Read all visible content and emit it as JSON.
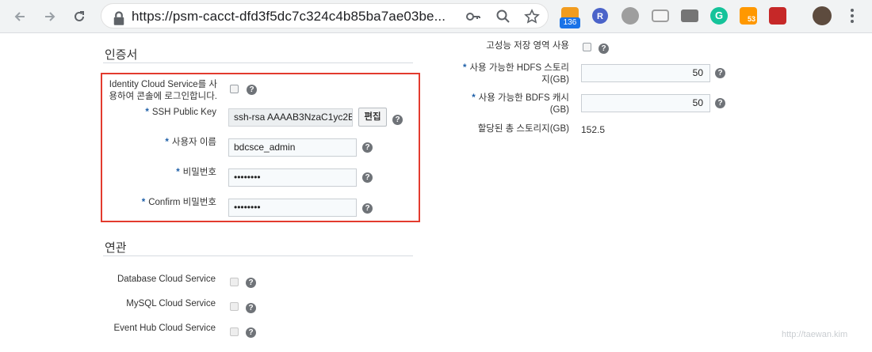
{
  "browser": {
    "url_main": "https://psm-cacct-dfd3f5dc7c324c4b85ba7ae03be...",
    "ext_badge_count": "136",
    "ext_r_label": "R",
    "ext_g_label": "G",
    "ext_53_label": "53"
  },
  "credentials": {
    "title": "인증서",
    "identity_label_line1": "Identity Cloud Service를 사",
    "identity_label_line2": "용하여 콘솔에 로그인합니다.",
    "ssh_label": "SSH Public Key",
    "ssh_value": "ssh-rsa AAAAB3NzaC1yc2E",
    "edit_button": "편집",
    "username_label": "사용자 이름",
    "username_value": "bdcsce_admin",
    "password_label": "비밀번호",
    "password_value": "••••••••",
    "confirm_label": "Confirm 비밀번호",
    "confirm_value": "••••••••"
  },
  "associations": {
    "title": "연관",
    "items": [
      {
        "label": "Database Cloud Service"
      },
      {
        "label": "MySQL Cloud Service"
      },
      {
        "label": "Event Hub Cloud Service"
      }
    ]
  },
  "storage": {
    "high_perf_label": "고성능 저장 영역 사용",
    "hdfs_label_line1": "사용 가능한 HDFS 스토리",
    "hdfs_label_line2": "지(GB)",
    "hdfs_value": "50",
    "bdfs_label_line1": "사용 가능한 BDFS 캐시",
    "bdfs_label_line2": "(GB)",
    "bdfs_value": "50",
    "total_label": "할당된 총 스토리지(GB)",
    "total_value": "152.5"
  },
  "help_glyph": "?",
  "required_mark": "*",
  "watermark": "http://taewan.kim",
  "colors": {
    "highlight_border": "#e33b2e",
    "required_star": "#1d5fa8",
    "help_icon": "#6f7378"
  }
}
